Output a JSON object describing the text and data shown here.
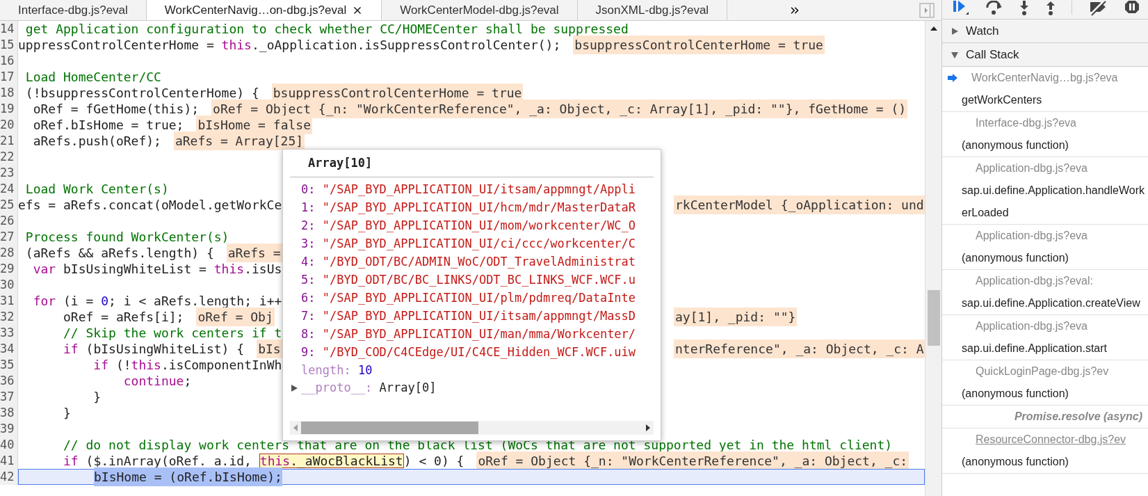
{
  "tabs": [
    {
      "label": "Interface-dbg.js?eval",
      "selected": false
    },
    {
      "label": "WorkCenterNavig…on-dbg.js?eval",
      "selected": true
    },
    {
      "label": "WorkCenterModel-dbg.js?eval",
      "selected": false
    },
    {
      "label": "JsonXML-dbg.js?eval",
      "selected": false
    }
  ],
  "editor": {
    "lines": [
      {
        "number": "14",
        "current": false,
        "parts": [
          {
            "kind": "code",
            "tokens": [
              {
                "kind": "comment",
                "text": " get Application configuration to check whether CC/HOMECenter shall be suppressed"
              }
            ]
          }
        ]
      },
      {
        "number": "15",
        "current": false,
        "parts": [
          {
            "kind": "code",
            "tokens": [
              {
                "kind": "plain",
                "text": "uppressControlCenterHome = "
              },
              {
                "kind": "keyword",
                "text": "this"
              },
              {
                "kind": "plain",
                "text": "._oApplication.isSuppressControlCenter();"
              }
            ]
          },
          {
            "kind": "value",
            "text": "bsuppressControlCenterHome = true"
          }
        ]
      },
      {
        "number": "16",
        "current": false
      },
      {
        "number": "17",
        "current": false,
        "parts": [
          {
            "kind": "code",
            "tokens": [
              {
                "kind": "comment",
                "text": " Load HomeCenter/CC"
              }
            ]
          }
        ]
      },
      {
        "number": "18",
        "current": false,
        "parts": [
          {
            "kind": "code",
            "tokens": [
              {
                "kind": "plain",
                "text": " (!bsuppressControlCenterHome) {"
              }
            ]
          },
          {
            "kind": "value",
            "text": "bsuppressControlCenterHome = true"
          }
        ]
      },
      {
        "number": "19",
        "current": false,
        "parts": [
          {
            "kind": "code",
            "tokens": [
              {
                "kind": "plain",
                "text": "  oRef = fGetHome(this);"
              }
            ]
          },
          {
            "kind": "value",
            "text": "oRef = Object {_n: \"WorkCenterReference\", _a: Object, _c: Array[1], _pid: \"\"}, fGetHome = ()"
          }
        ]
      },
      {
        "number": "20",
        "current": false,
        "parts": [
          {
            "kind": "code",
            "tokens": [
              {
                "kind": "plain",
                "text": "  oRef.bIsHome = true;"
              }
            ]
          },
          {
            "kind": "value",
            "text": "bIsHome = false"
          }
        ]
      },
      {
        "number": "21",
        "current": false,
        "parts": [
          {
            "kind": "code",
            "tokens": [
              {
                "kind": "plain",
                "text": "  aRefs.push(oRef);"
              }
            ]
          },
          {
            "kind": "value",
            "text": "aRefs = Array[25]"
          }
        ]
      },
      {
        "number": "22",
        "current": false
      },
      {
        "number": "23",
        "current": false
      },
      {
        "number": "24",
        "current": false,
        "parts": [
          {
            "kind": "code",
            "tokens": [
              {
                "kind": "comment",
                "text": " Load Work Center(s)"
              }
            ]
          }
        ]
      },
      {
        "number": "25",
        "current": false,
        "parts": [
          {
            "kind": "code",
            "tokens": [
              {
                "kind": "plain",
                "text": "efs = aRefs.concat(oModel.getWorkCe"
              }
            ]
          }
        ],
        "right": [
          {
            "kind": "value",
            "text": "rkCenterModel {_oApplication: und"
          }
        ]
      },
      {
        "number": "26",
        "current": false
      },
      {
        "number": "27",
        "current": false,
        "parts": [
          {
            "kind": "code",
            "tokens": [
              {
                "kind": "comment",
                "text": " Process found WorkCenter(s)"
              }
            ]
          }
        ]
      },
      {
        "number": "28",
        "current": false,
        "parts": [
          {
            "kind": "code",
            "tokens": [
              {
                "kind": "plain",
                "text": " (aRefs && aRefs.length) {"
              }
            ]
          },
          {
            "kind": "value",
            "text": "aRefs ="
          }
        ]
      },
      {
        "number": "29",
        "current": false,
        "parts": [
          {
            "kind": "code",
            "tokens": [
              {
                "kind": "keyword",
                "text": "  var"
              },
              {
                "kind": "plain",
                "text": " bIsUsingWhiteList = "
              },
              {
                "kind": "keyword",
                "text": "this"
              },
              {
                "kind": "plain",
                "text": ".isUs"
              }
            ]
          }
        ]
      },
      {
        "number": "30",
        "current": false
      },
      {
        "number": "31",
        "current": false,
        "parts": [
          {
            "kind": "code",
            "tokens": [
              {
                "kind": "keyword",
                "text": "  for"
              },
              {
                "kind": "plain",
                "text": " (i = "
              },
              {
                "kind": "number",
                "text": "0"
              },
              {
                "kind": "plain",
                "text": "; i < aRefs.length; i++"
              }
            ]
          }
        ]
      },
      {
        "number": "32",
        "current": false,
        "parts": [
          {
            "kind": "code",
            "tokens": [
              {
                "kind": "plain",
                "text": "      oRef = aRefs[i];"
              }
            ]
          },
          {
            "kind": "value",
            "text": "oRef = Obj"
          }
        ],
        "right": [
          {
            "kind": "value",
            "text": "ay[1], _pid: \"\"}"
          }
        ]
      },
      {
        "number": "33",
        "current": false,
        "parts": [
          {
            "kind": "code",
            "tokens": [
              {
                "kind": "comment",
                "text": "      // Skip the work centers if t"
              }
            ]
          }
        ]
      },
      {
        "number": "34",
        "current": false,
        "parts": [
          {
            "kind": "code",
            "tokens": [
              {
                "kind": "keyword",
                "text": "      if"
              },
              {
                "kind": "plain",
                "text": " (bIsUsingWhiteList) {"
              }
            ]
          },
          {
            "kind": "value",
            "text": "bIs"
          }
        ],
        "right": [
          {
            "kind": "value",
            "text": "nterReference\", _a: Object, _c: A"
          }
        ]
      },
      {
        "number": "35",
        "current": false,
        "parts": [
          {
            "kind": "code",
            "tokens": [
              {
                "kind": "keyword",
                "text": "          if"
              },
              {
                "kind": "plain",
                "text": " (!"
              },
              {
                "kind": "keyword",
                "text": "this"
              },
              {
                "kind": "plain",
                "text": ".isComponentInWh"
              }
            ]
          }
        ]
      },
      {
        "number": "36",
        "current": false,
        "parts": [
          {
            "kind": "code",
            "tokens": [
              {
                "kind": "keyword",
                "text": "              continue"
              },
              {
                "kind": "plain",
                "text": ";"
              }
            ]
          }
        ]
      },
      {
        "number": "37",
        "current": false,
        "parts": [
          {
            "kind": "code",
            "tokens": [
              {
                "kind": "plain",
                "text": "          }"
              }
            ]
          }
        ]
      },
      {
        "number": "38",
        "current": false,
        "parts": [
          {
            "kind": "code",
            "tokens": [
              {
                "kind": "plain",
                "text": "      }"
              }
            ]
          }
        ]
      },
      {
        "number": "39",
        "current": false
      },
      {
        "number": "40",
        "current": false,
        "parts": [
          {
            "kind": "code",
            "tokens": [
              {
                "kind": "comment",
                "text": "      // do not display work centers that are on the black list (WoCs that are not supported yet in the html client)"
              }
            ]
          }
        ]
      },
      {
        "number": "41",
        "current": false,
        "parts": [
          {
            "kind": "code",
            "tokens": [
              {
                "kind": "keyword",
                "text": "      if"
              },
              {
                "kind": "plain",
                "text": " ($.inArray(oRef._a.id, "
              }
            ]
          },
          {
            "kind": "match",
            "tokens": [
              {
                "kind": "keyword",
                "text": "this"
              },
              {
                "kind": "plain",
                "text": "._aWocBlackList"
              }
            ]
          },
          {
            "kind": "code",
            "tokens": [
              {
                "kind": "plain",
                "text": ") < 0) {"
              }
            ]
          },
          {
            "kind": "value",
            "text": "oRef = Object {_n: \"WorkCenterReference\", _a: Object, _c:"
          }
        ]
      },
      {
        "number": "42",
        "current": true,
        "parts": [
          {
            "kind": "selection",
            "tokens": [
              {
                "kind": "plain",
                "text": "bIsHome = (oRef.bIsHome);"
              }
            ]
          }
        ]
      }
    ],
    "popup": {
      "title": "Array[10]",
      "entries": [
        {
          "key": "0:",
          "value": "\"/SAP_BYD_APPLICATION_UI/itsam/appmngt/Appli"
        },
        {
          "key": "1:",
          "value": "\"/SAP_BYD_APPLICATION_UI/hcm/mdr/MasterDataR"
        },
        {
          "key": "2:",
          "value": "\"/SAP_BYD_APPLICATION_UI/mom/workcenter/WC_O"
        },
        {
          "key": "3:",
          "value": "\"/SAP_BYD_APPLICATION_UI/ci/ccc/workcenter/C"
        },
        {
          "key": "4:",
          "value": "\"/BYD_ODT/BC/ADMIN_WoC/ODT_TravelAdministrat"
        },
        {
          "key": "5:",
          "value": "\"/BYD_ODT/BC/BC_LINKS/ODT_BC_LINKS_WCF.WCF.u"
        },
        {
          "key": "6:",
          "value": "\"/SAP_BYD_APPLICATION_UI/plm/pdmreq/DataInte"
        },
        {
          "key": "7:",
          "value": "\"/SAP_BYD_APPLICATION_UI/itsam/appmngt/MassD"
        },
        {
          "key": "8:",
          "value": "\"/SAP_BYD_APPLICATION_UI/man/mma/Workcenter/"
        },
        {
          "key": "9:",
          "value": "\"/BYD_COD/C4CEdge/UI/C4CE_Hidden_WCF.WCF.uiw"
        }
      ],
      "length": {
        "key": "length:",
        "value": "10"
      },
      "proto": {
        "key": "__proto__:",
        "value": "Array[0]",
        "expanded": false
      }
    }
  },
  "sidebar": {
    "sections": [
      {
        "title": "Watch",
        "expanded": false
      },
      {
        "title": "Call Stack",
        "expanded": true
      }
    ],
    "call_stack": [
      {
        "kind": "frame",
        "name": "getWorkCenters",
        "location": "WorkCenterNavig…bg.js?eva",
        "current": true,
        "hovered": false
      },
      {
        "kind": "frame",
        "name": "(anonymous function)",
        "location": "Interface-dbg.js?eva",
        "current": false,
        "hovered": false
      },
      {
        "kind": "frame",
        "name": "sap.ui.define.Application.handleWorkerLoaded",
        "location": "Application-dbg.js?eva",
        "current": false,
        "hovered": false
      },
      {
        "kind": "frame",
        "name": "(anonymous function)",
        "location": "Application-dbg.js?eva",
        "current": false,
        "hovered": false
      },
      {
        "kind": "frame",
        "name": "sap.ui.define.Application.createView",
        "location": "Application-dbg.js?eval:",
        "current": false,
        "hovered": false
      },
      {
        "kind": "frame",
        "name": "sap.ui.define.Application.start",
        "location": "Application-dbg.js?eva",
        "current": false,
        "hovered": false
      },
      {
        "kind": "frame",
        "name": "(anonymous function)",
        "location": "QuickLoginPage-dbg.js?ev",
        "current": false,
        "hovered": false
      },
      {
        "kind": "async",
        "label": "Promise.resolve (async)"
      },
      {
        "kind": "frame",
        "name": "(anonymous function)",
        "location": "ResourceConnector-dbg.js?ev",
        "current": false,
        "hovered": true
      }
    ]
  }
}
